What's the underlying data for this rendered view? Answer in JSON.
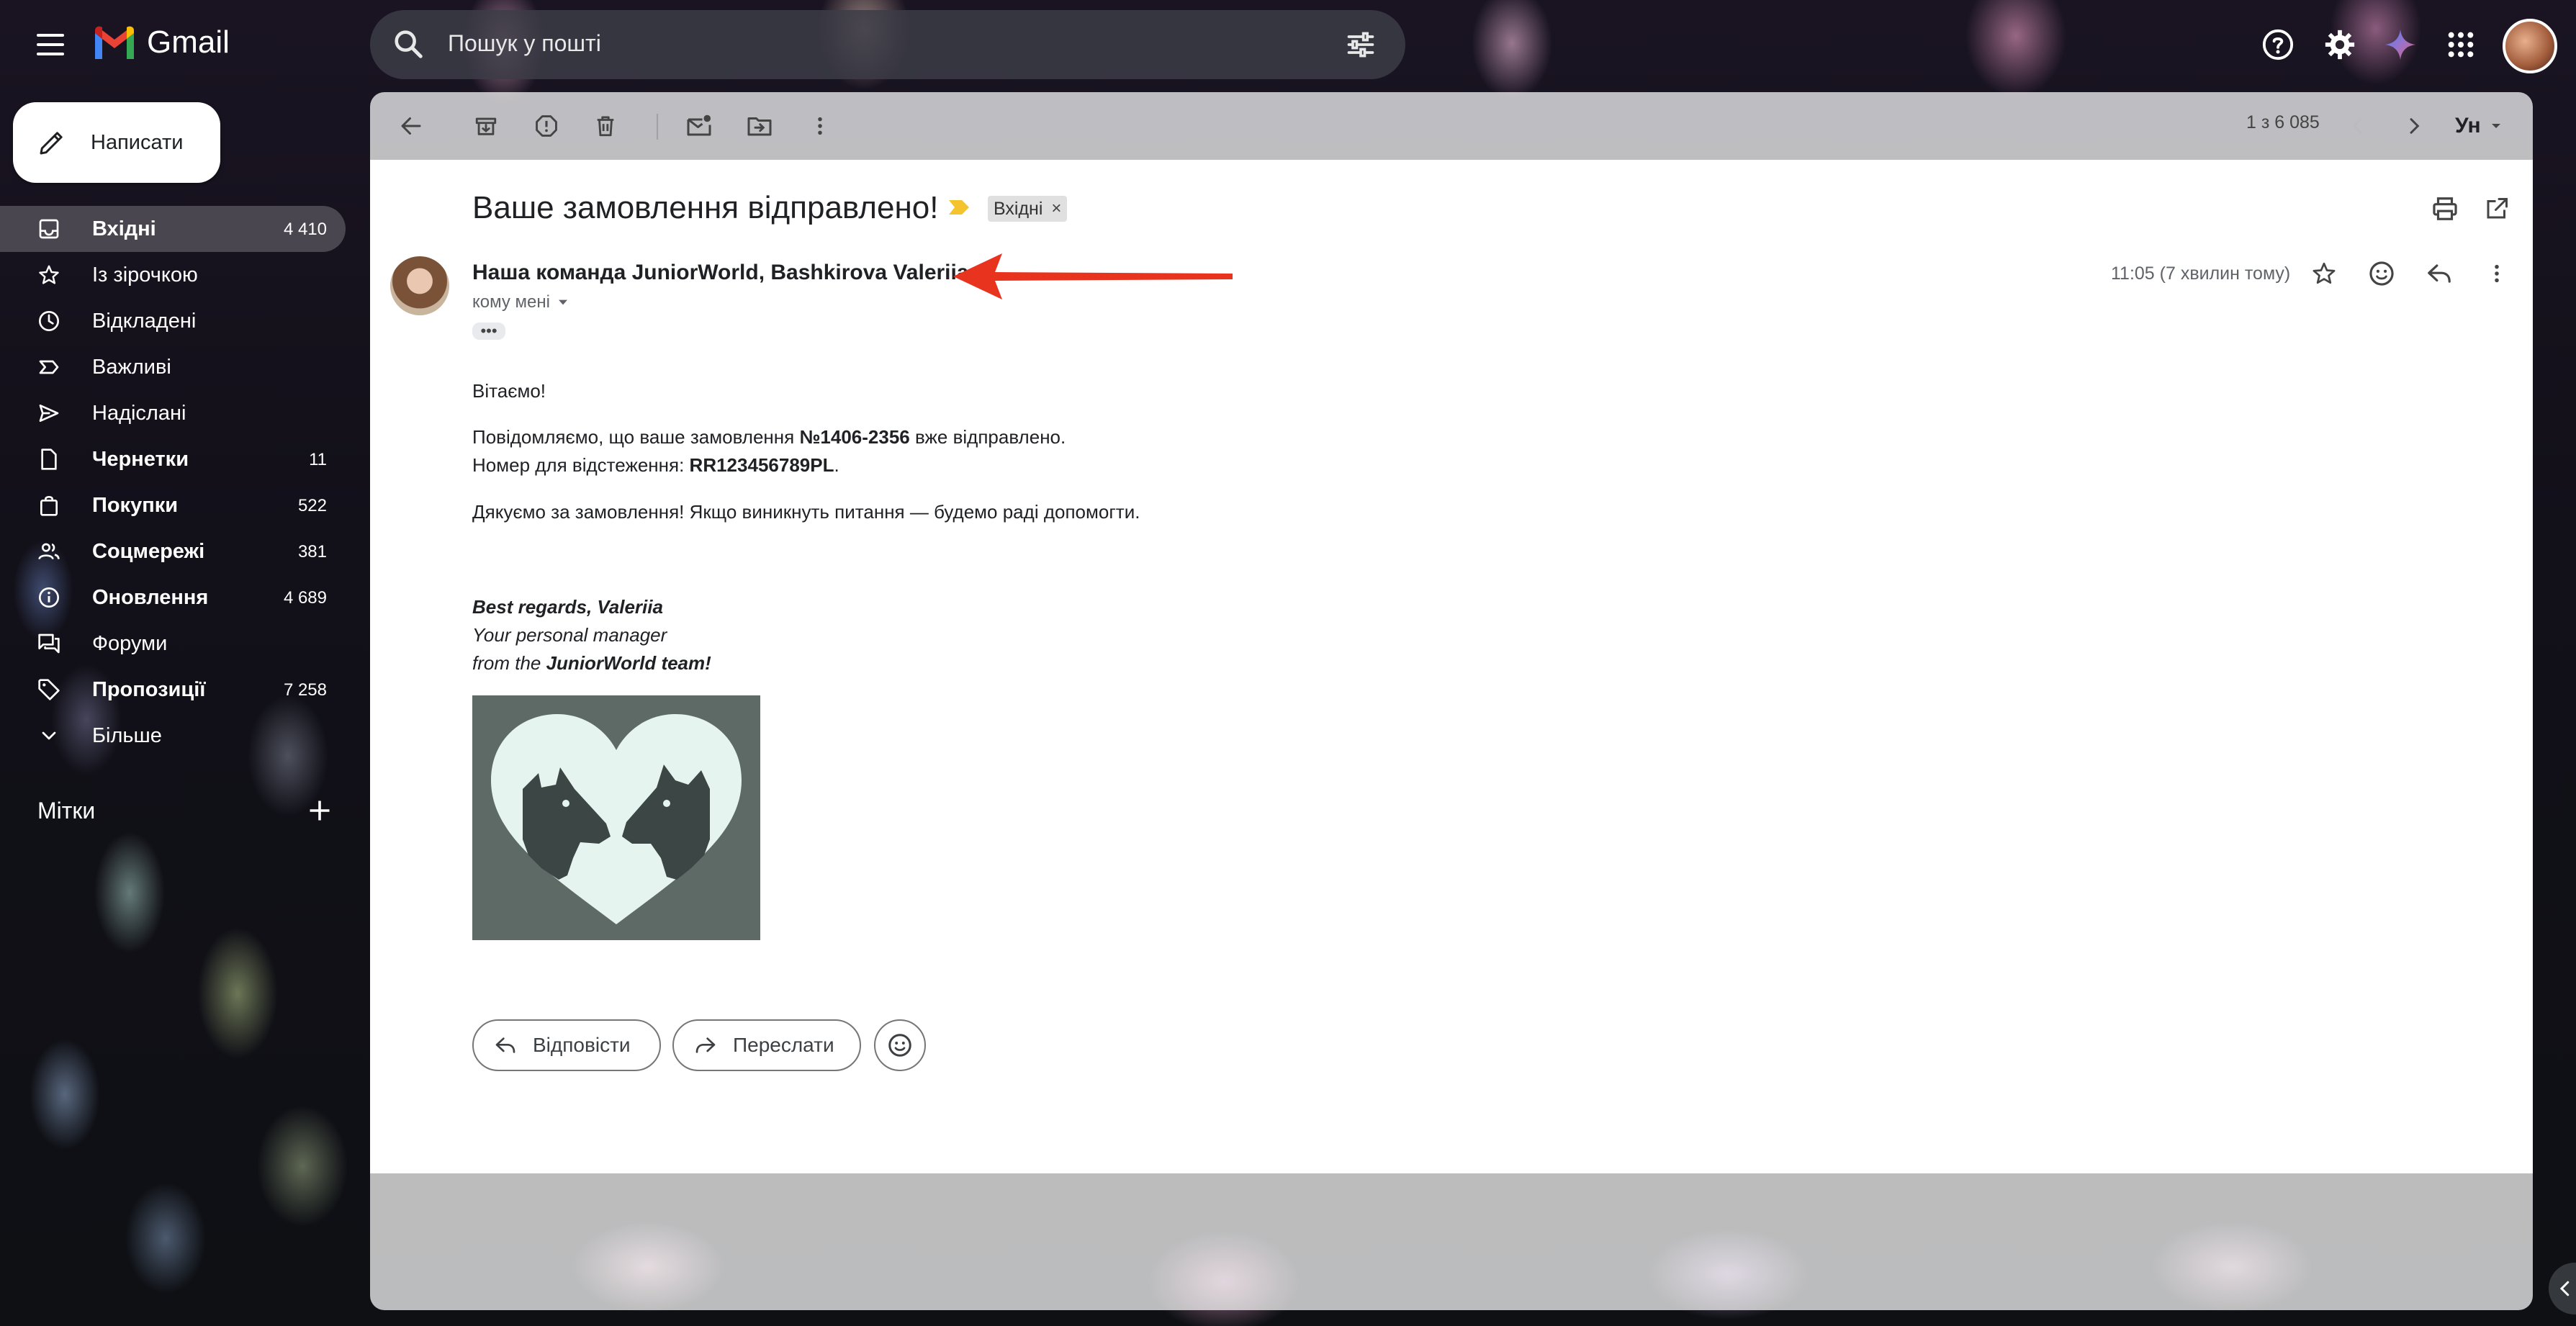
{
  "app": {
    "name": "Gmail",
    "search_placeholder": "Пошук у пошті"
  },
  "compose": {
    "label": "Написати"
  },
  "sidebar": {
    "items": [
      {
        "label": "Вхідні",
        "count": "4 410",
        "bold": true,
        "active": true,
        "icon": "inbox-icon"
      },
      {
        "label": "Із зірочкою",
        "count": "",
        "bold": false,
        "icon": "star-icon"
      },
      {
        "label": "Відкладені",
        "count": "",
        "bold": false,
        "icon": "clock-icon"
      },
      {
        "label": "Важливі",
        "count": "",
        "bold": false,
        "icon": "important-icon"
      },
      {
        "label": "Надіслані",
        "count": "",
        "bold": false,
        "icon": "send-icon"
      },
      {
        "label": "Чернетки",
        "count": "11",
        "bold": true,
        "icon": "draft-icon"
      },
      {
        "label": "Покупки",
        "count": "522",
        "bold": true,
        "icon": "shopping-bag-icon"
      },
      {
        "label": "Соцмережі",
        "count": "381",
        "bold": true,
        "icon": "people-icon"
      },
      {
        "label": "Оновлення",
        "count": "4 689",
        "bold": true,
        "icon": "info-icon"
      },
      {
        "label": "Форуми",
        "count": "",
        "bold": false,
        "icon": "forum-icon"
      },
      {
        "label": "Пропозиції",
        "count": "7 258",
        "bold": true,
        "icon": "tag-icon"
      },
      {
        "label": "Більше",
        "count": "",
        "bold": false,
        "icon": "chevron-down-icon"
      }
    ],
    "labels_header": "Мітки"
  },
  "toolbar": {
    "pager": "1 з 6 085",
    "input_tool": "Ун"
  },
  "email": {
    "subject": "Ваше замовлення відправлено!",
    "label_chip": "Вхідні",
    "sender": "Наша команда JuniorWorld, Bashkirova Valeriia",
    "to": "кому мені",
    "time": "11:05 (7 хвилин тому)",
    "greeting": "Вітаємо!",
    "line1_pre": "Повідомляємо, що ваше замовлення ",
    "order_number": "№1406-2356",
    "line1_post": " вже відправлено.",
    "line2_pre": "Номер для відстеження: ",
    "tracking": "RR123456789PL",
    "line2_post": ".",
    "thanks": "Дякуємо за замовлення! Якщо виникнуть питання — будемо раді допомогти.",
    "sig_line1": "Best regards, Valeriia",
    "sig_line2": "Your personal manager",
    "sig_line3_pre": "from the ",
    "sig_line3_bold": "JuniorWorld team!"
  },
  "actions": {
    "reply": "Відповісти",
    "forward": "Переслати"
  },
  "colors": {
    "accent_red": "#ea4335",
    "annotation_arrow": "#e8331f",
    "importance_marker": "#f4c430"
  }
}
